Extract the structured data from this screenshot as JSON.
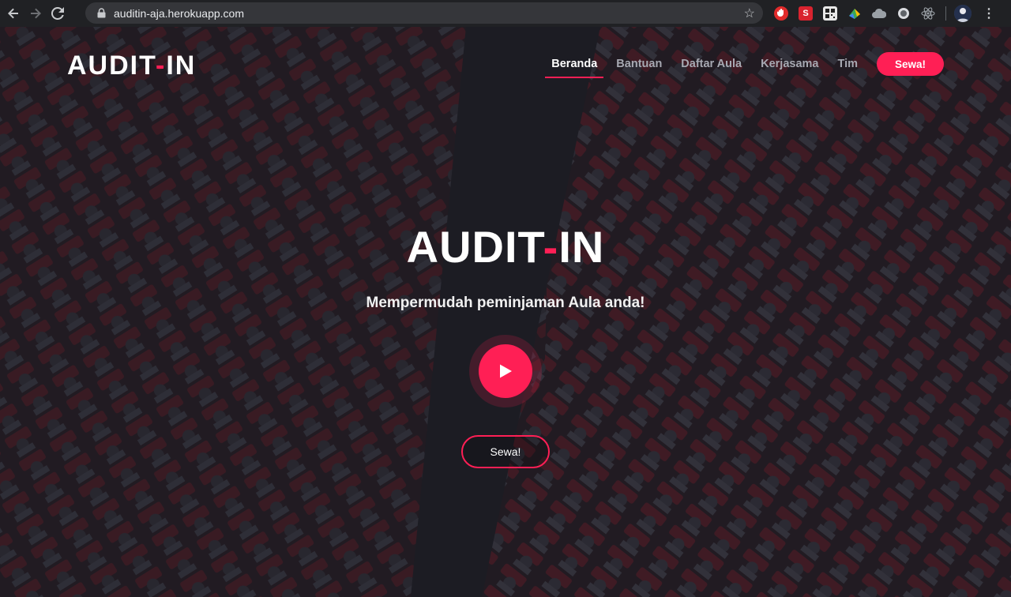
{
  "browser": {
    "url": "auditin-aja.herokuapp.com",
    "back_icon": "arrow-left-icon",
    "forward_icon": "arrow-right-icon",
    "reload_icon": "reload-icon",
    "lock_icon": "lock-icon",
    "bookmark_icon": "star-icon",
    "extensions": [
      {
        "name": "ublock-icon",
        "color": "#e12b2b"
      },
      {
        "name": "s-extension-icon",
        "color": "#d9232f",
        "glyph": "S"
      },
      {
        "name": "qr-icon",
        "color": "#e8e8e8"
      },
      {
        "name": "colorful-extension-icon",
        "color": "#3aa757"
      },
      {
        "name": "cloud-icon",
        "color": "#9aa0a6"
      },
      {
        "name": "circle-extension-icon",
        "color": "#dadce0"
      },
      {
        "name": "react-devtools-icon",
        "color": "#61dafb"
      }
    ],
    "menu_icon": "vertical-dots-icon"
  },
  "site": {
    "logo_main": "AUDIT",
    "logo_dash": "-",
    "logo_end": "IN",
    "nav": [
      {
        "label": "Beranda",
        "active": true
      },
      {
        "label": "Bantuan",
        "active": false
      },
      {
        "label": "Daftar Aula",
        "active": false
      },
      {
        "label": "Kerjasama",
        "active": false
      },
      {
        "label": "Tim",
        "active": false
      }
    ],
    "nav_cta": "Sewa!",
    "hero": {
      "title_main": "AUDIT",
      "title_dash": "-",
      "title_end": "IN",
      "subtitle": "Mempermudah peminjaman Aula anda!",
      "play_icon": "play-icon",
      "cta": "Sewa!"
    },
    "colors": {
      "accent": "#ff1f55",
      "overlay": "#12121a",
      "text": "#ffffff",
      "nav_inactive": "#a7a9b2"
    }
  }
}
